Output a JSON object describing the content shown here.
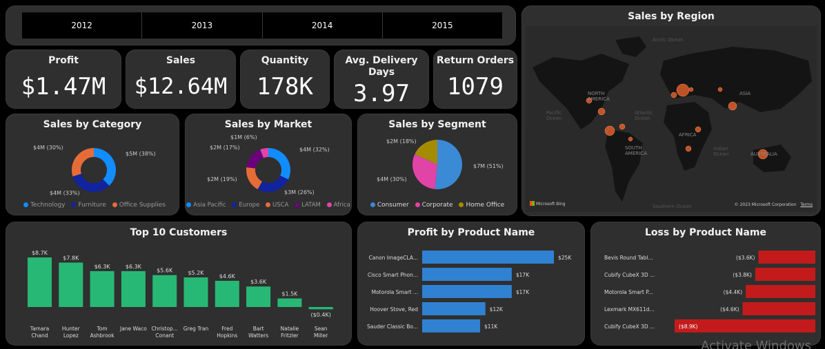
{
  "filters": {
    "years": [
      "2012",
      "2013",
      "2014",
      "2015"
    ]
  },
  "kpis": [
    {
      "label": "Profit",
      "value": "$1.47M"
    },
    {
      "label": "Sales",
      "value": "$12.64M"
    },
    {
      "label": "Quantity",
      "value": "178K"
    },
    {
      "label": "Avg. Delivery Days",
      "value": "3.97"
    },
    {
      "label": "Return Orders",
      "value": "1079"
    }
  ],
  "map": {
    "title": "Sales by Region",
    "labels": [
      "NORTH AMERICA",
      "SOUTH AMERICA",
      "AFRICA",
      "ASIA",
      "AUSTRALIA",
      "Arctic Ocean",
      "Atlantic Ocean",
      "Pacific Ocean",
      "Indian Ocean",
      "Southern Ocean"
    ],
    "bing": "Microsoft Bing",
    "copyright": "© 2023 Microsoft Corporation",
    "terms": "Terms"
  },
  "colors": {
    "technology": "#118dff",
    "furniture": "#12239e",
    "office": "#e66c37",
    "latam": "#6b007b",
    "africa": "#e044a7",
    "homeoffice": "#a58b00",
    "consumer": "#3a8ad6",
    "profit_bar": "#3081d1",
    "loss_bar": "#c31b1b",
    "customer_bar": "#27b875"
  },
  "chart_data": [
    {
      "type": "pie",
      "title": "Sales by Category",
      "labels": [
        "Technology",
        "Furniture",
        "Office Supplies"
      ],
      "values": [
        38,
        33,
        30
      ],
      "data_labels": [
        "$5M (38%)",
        "$4M (33%)",
        "$4M (30%)"
      ]
    },
    {
      "type": "pie",
      "title": "Sales by Market",
      "labels": [
        "Asia Pacific",
        "Europe",
        "USCA",
        "LATAM",
        "Africa"
      ],
      "values": [
        32,
        26,
        19,
        17,
        6
      ],
      "data_labels": [
        "$4M (32%)",
        "$3M (26%)",
        "$2M (19%)",
        "$2M (17%)",
        "$1M (6%)"
      ]
    },
    {
      "type": "pie",
      "title": "Sales by Segment",
      "labels": [
        "Consumer",
        "Corporate",
        "Home Office"
      ],
      "values": [
        51,
        30,
        18
      ],
      "data_labels": [
        "$7M (51%)",
        "$4M (30%)",
        "$2M (18%)"
      ]
    },
    {
      "type": "bar",
      "title": "Top 10 Customers",
      "categories": [
        "Tamara Chand",
        "Hunter Lopez",
        "Tom Ashbrook",
        "Jane Waco",
        "Christop... Conant",
        "Greg Tran",
        "Fred Hopkins",
        "Bart Watters",
        "Natalie Fritzler",
        "Sean Miller"
      ],
      "values": [
        8.7,
        7.8,
        6.3,
        6.3,
        5.6,
        5.2,
        4.6,
        3.6,
        1.5,
        -0.4
      ],
      "data_labels": [
        "$8.7K",
        "$7.8K",
        "$6.3K",
        "$6.3K",
        "$5.6K",
        "$5.2K",
        "$4.6K",
        "$3.6K",
        "$1.5K",
        "($0.4K)"
      ]
    },
    {
      "type": "bar",
      "title": "Profit by Product Name",
      "categories": [
        "Canon ImageCLA...",
        "Cisco Smart Phon...",
        "Motorola Smart ...",
        "Hoover Stove, Red",
        "Sauder Classic Bo..."
      ],
      "values": [
        25,
        17,
        17,
        12,
        11
      ],
      "data_labels": [
        "$25K",
        "$17K",
        "$17K",
        "$12K",
        "$11K"
      ]
    },
    {
      "type": "bar",
      "title": "Loss by Product Name",
      "categories": [
        "Bevis Round Tabl...",
        "Cubify CubeX 3D ...",
        "Motorola Smart P...",
        "Lexmark MX611d...",
        "Cubify CubeX 3D ..."
      ],
      "values": [
        -3.6,
        -3.8,
        -4.4,
        -4.6,
        -8.9
      ],
      "data_labels": [
        "($3.6K)",
        "($3.8K)",
        "($4.4K)",
        "($4.6K)",
        "($8.9K)"
      ]
    }
  ],
  "watermark": "Activate Windows"
}
